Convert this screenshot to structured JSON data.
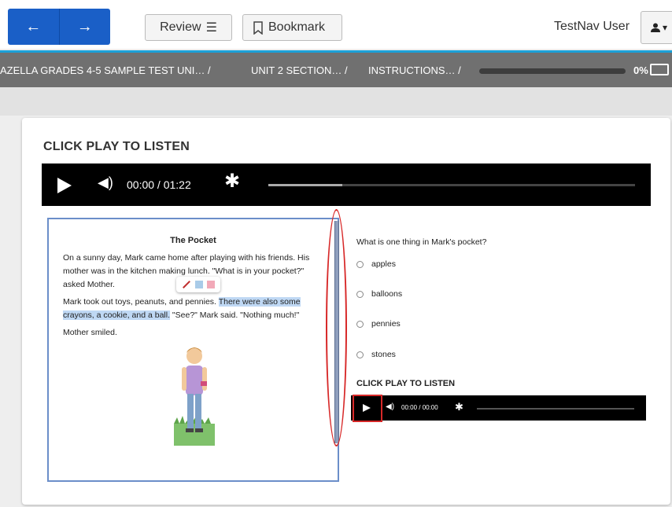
{
  "header": {
    "back_icon": "arrow-left-icon",
    "forward_icon": "arrow-right-icon",
    "review_label": "Review",
    "review_icon": "list-icon",
    "bookmark_label": "Bookmark",
    "bookmark_icon": "bookmark-icon",
    "user_name": "TestNav User",
    "user_icon": "user-icon"
  },
  "breadcrumb": {
    "items": [
      "AZELLA GRADES 4-5 SAMPLE TEST UNI… /",
      "UNIT 2 SECTION… /",
      "INSTRUCTIONS… /"
    ],
    "progress": "0%",
    "progress_value": 0
  },
  "main": {
    "title": "CLICK PLAY TO LISTEN",
    "player": {
      "time": "00:00 / 01:22"
    },
    "passage": {
      "title": "The Pocket",
      "p1": "On a sunny day, Mark came home after playing with his friends. His mother was in the kitchen making lunch. \"What is in your pocket?\" asked Mother.",
      "p2_start": "Mark took out toys, peanuts, and pennies. ",
      "p2_highlight": "There were also some crayons, a cookie, and a ball.",
      "p2_end": " \"See?\" Mark said. \"Nothing much!\"",
      "p3": "Mother smiled."
    },
    "question": {
      "prompt": "What is one thing in Mark's pocket?",
      "options": [
        "apples",
        "balloons",
        "pennies",
        "stones"
      ],
      "audio_title": "CLICK PLAY TO LISTEN",
      "audio_time": "00:00 / 00:00"
    }
  },
  "colors": {
    "nav_blue": "#1a5fc7",
    "accent_rule": "#1ba1d8",
    "crumb_bar": "#707070",
    "highlight": "#bfd8f4",
    "annotation_red": "#d72828"
  }
}
